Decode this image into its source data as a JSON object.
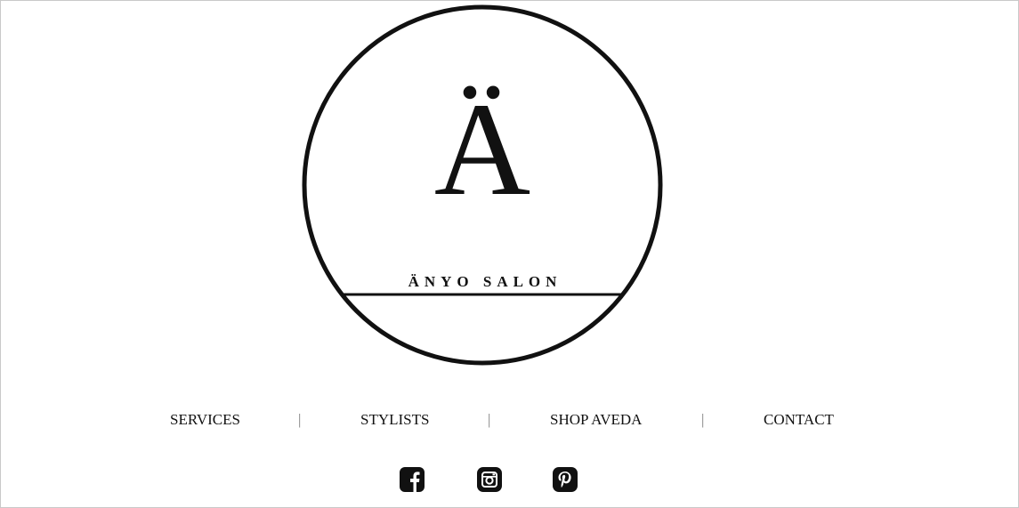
{
  "logo": {
    "letter": "Ä",
    "name": "ÄNYO SALON"
  },
  "nav": {
    "items": [
      {
        "label": "SERVICES"
      },
      {
        "label": "STYLISTS"
      },
      {
        "label": "SHOP AVEDA"
      },
      {
        "label": "CONTACT"
      }
    ],
    "separator": "|"
  },
  "social": {
    "icons": [
      "facebook-icon",
      "instagram-icon",
      "pinterest-icon"
    ]
  },
  "colors": {
    "foreground": "#111111",
    "background": "#ffffff",
    "separator": "#7a7a7a"
  }
}
